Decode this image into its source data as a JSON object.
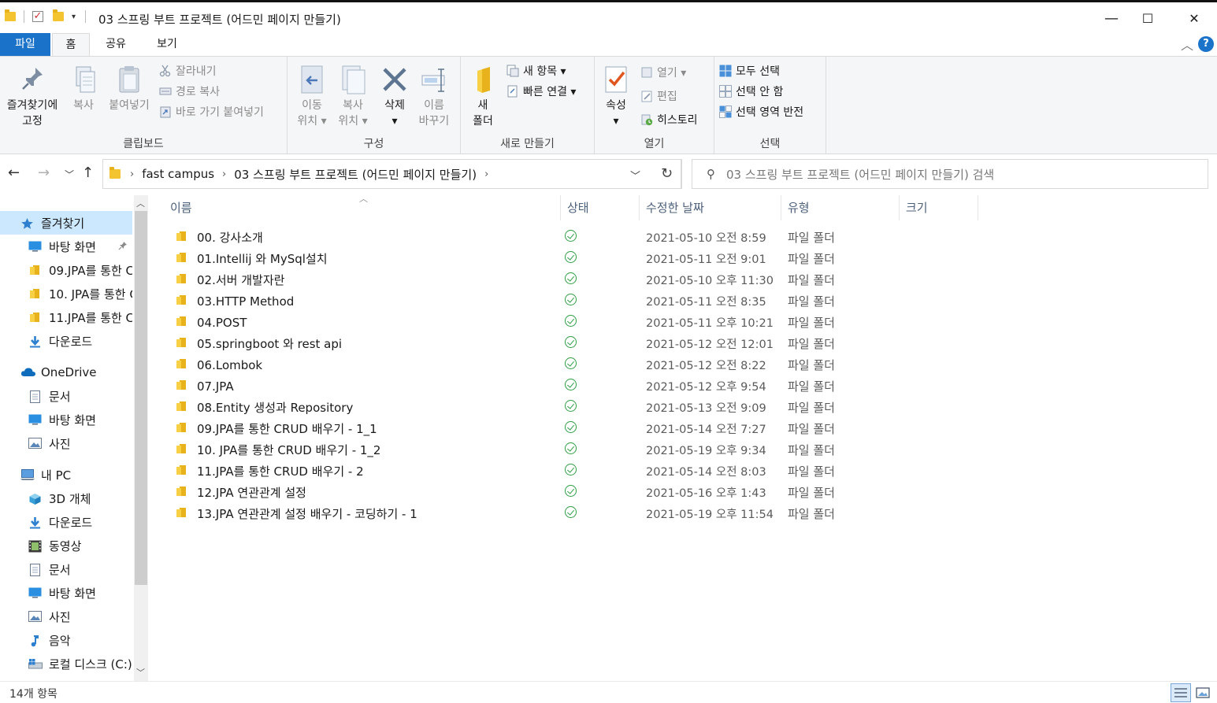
{
  "window": {
    "title": "03 스프링 부트 프로젝트 (어드민 페이지 만들기)",
    "controls": {
      "minimize": "—",
      "maximize": "☐",
      "close": "✕"
    }
  },
  "tabs": {
    "file": "파일",
    "home": "홈",
    "share": "공유",
    "view": "보기"
  },
  "ribbon": {
    "clipboard": {
      "label": "클립보드",
      "pin": "즐겨찾기에\n고정",
      "copy": "복사",
      "paste": "붙여넣기",
      "cut": "잘라내기",
      "copy_path": "경로 복사",
      "paste_shortcut": "바로 가기 붙여넣기"
    },
    "organize": {
      "label": "구성",
      "move_to": "이동\n위치 ▾",
      "copy_to": "복사\n위치 ▾",
      "delete": "삭제\n▾",
      "rename": "이름\n바꾸기"
    },
    "new": {
      "label": "새로 만들기",
      "new_folder": "새\n폴더",
      "new_item": "새 항목 ▾",
      "easy_access": "빠른 연결 ▾"
    },
    "open": {
      "label": "열기",
      "properties": "속성\n▾",
      "open": "열기 ▾",
      "edit": "편집",
      "history": "히스토리"
    },
    "select": {
      "label": "선택",
      "select_all": "모두 선택",
      "select_none": "선택 안 함",
      "invert": "선택 영역 반전"
    }
  },
  "address": {
    "crumbs": [
      "fast campus",
      "03 스프링 부트 프로젝트 (어드민 페이지 만들기)"
    ],
    "search_placeholder": "03 스프링 부트 프로젝트 (어드민 페이지 만들기) 검색"
  },
  "nav": {
    "items": [
      {
        "label": "즐겨찾기",
        "icon": "star-icon",
        "level": 0,
        "selected": true
      },
      {
        "label": "바탕 화면",
        "icon": "desktop-icon",
        "level": 1,
        "pinned": true
      },
      {
        "label": "09.JPA를 통한 C",
        "icon": "folder-icon",
        "level": 1
      },
      {
        "label": "10. JPA를 통한 C",
        "icon": "folder-icon",
        "level": 1
      },
      {
        "label": "11.JPA를 통한 C",
        "icon": "folder-icon",
        "level": 1
      },
      {
        "label": "다운로드",
        "icon": "download-icon",
        "level": 1
      },
      {
        "label": "OneDrive",
        "icon": "cloud-icon",
        "level": 0
      },
      {
        "label": "문서",
        "icon": "document-icon",
        "level": 1
      },
      {
        "label": "바탕 화면",
        "icon": "desktop-icon",
        "level": 1
      },
      {
        "label": "사진",
        "icon": "picture-icon",
        "level": 1
      },
      {
        "label": "내 PC",
        "icon": "pc-icon",
        "level": 0
      },
      {
        "label": "3D 개체",
        "icon": "cube-icon",
        "level": 1
      },
      {
        "label": "다운로드",
        "icon": "download-icon",
        "level": 1
      },
      {
        "label": "동영상",
        "icon": "video-icon",
        "level": 1
      },
      {
        "label": "문서",
        "icon": "document-icon",
        "level": 1
      },
      {
        "label": "바탕 화면",
        "icon": "desktop-icon",
        "level": 1
      },
      {
        "label": "사진",
        "icon": "picture-icon",
        "level": 1
      },
      {
        "label": "음악",
        "icon": "music-icon",
        "level": 1
      },
      {
        "label": "로컬 디스크 (C:)",
        "icon": "disk-icon",
        "level": 1
      }
    ]
  },
  "columns": {
    "name": "이름",
    "status": "상태",
    "modified": "수정한 날짜",
    "type": "유형",
    "size": "크기"
  },
  "files": [
    {
      "name": "00. 강사소개",
      "date": "2021-05-10 오전 8:59",
      "type": "파일 폴더"
    },
    {
      "name": "01.Intellij 와 MySql설치",
      "date": "2021-05-11 오전 9:01",
      "type": "파일 폴더"
    },
    {
      "name": "02.서버 개발자란",
      "date": "2021-05-10 오후 11:30",
      "type": "파일 폴더"
    },
    {
      "name": "03.HTTP Method",
      "date": "2021-05-11 오전 8:35",
      "type": "파일 폴더"
    },
    {
      "name": "04.POST",
      "date": "2021-05-11 오후 10:21",
      "type": "파일 폴더"
    },
    {
      "name": "05.springboot 와 rest api",
      "date": "2021-05-12 오전 12:01",
      "type": "파일 폴더"
    },
    {
      "name": "06.Lombok",
      "date": "2021-05-12 오전 8:22",
      "type": "파일 폴더"
    },
    {
      "name": "07.JPA",
      "date": "2021-05-12 오후 9:54",
      "type": "파일 폴더"
    },
    {
      "name": "08.Entity 생성과 Repository",
      "date": "2021-05-13 오전 9:09",
      "type": "파일 폴더"
    },
    {
      "name": "09.JPA를 통한 CRUD 배우기 - 1_1",
      "date": "2021-05-14 오전 7:27",
      "type": "파일 폴더"
    },
    {
      "name": "10. JPA를 통한 CRUD 배우기 - 1_2",
      "date": "2021-05-19 오후 9:34",
      "type": "파일 폴더"
    },
    {
      "name": "11.JPA를 통한 CRUD 배우기 - 2",
      "date": "2021-05-14 오전 8:03",
      "type": "파일 폴더"
    },
    {
      "name": "12.JPA 연관관계 설정",
      "date": "2021-05-16 오후 1:43",
      "type": "파일 폴더"
    },
    {
      "name": "13.JPA 연관관계 설정 배우기 - 코딩하기 - 1",
      "date": "2021-05-19 오후 11:54",
      "type": "파일 폴더"
    }
  ],
  "statusbar": {
    "count": "14개 항목"
  },
  "colors": {
    "accent": "#1a73c9",
    "selection": "#cce8ff",
    "sync_ok": "#2e9e44",
    "folder": "#f4c430"
  }
}
